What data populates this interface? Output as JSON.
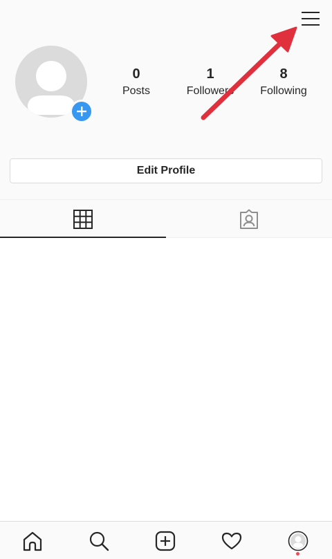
{
  "profile": {
    "stats": [
      {
        "value": "0",
        "label": "Posts"
      },
      {
        "value": "1",
        "label": "Followers"
      },
      {
        "value": "8",
        "label": "Following"
      }
    ],
    "edit_profile_label": "Edit Profile"
  },
  "header": {
    "menu_icon": "hamburger-menu-icon"
  },
  "tabs": [
    {
      "icon": "grid-icon",
      "active": true
    },
    {
      "icon": "tagged-photos-icon",
      "active": false
    }
  ],
  "bottom_nav": [
    {
      "icon": "home-icon"
    },
    {
      "icon": "search-icon"
    },
    {
      "icon": "new-post-icon"
    },
    {
      "icon": "activity-heart-icon"
    },
    {
      "icon": "profile-avatar-icon",
      "has_notification": true
    }
  ],
  "colors": {
    "accent_blue": "#3897f0",
    "annotation_arrow": "#e0303e",
    "notification": "#ed4956",
    "text": "#262626"
  }
}
